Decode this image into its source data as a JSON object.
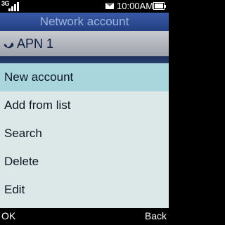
{
  "status_bar": {
    "network_type": "3G",
    "time": "10:00AM",
    "signal_bars": 4,
    "battery_level": 1.0,
    "icons": [
      "signal-icon",
      "message-icon",
      "battery-icon"
    ]
  },
  "title": "Network account",
  "account": {
    "icon": "phone-handset-icon",
    "name": "APN 1"
  },
  "menu": {
    "items": [
      {
        "label": "New account",
        "selected": true
      },
      {
        "label": "Add from list",
        "selected": false
      },
      {
        "label": "Search",
        "selected": false
      },
      {
        "label": "Delete",
        "selected": false
      },
      {
        "label": "Edit",
        "selected": false
      }
    ]
  },
  "softkeys": {
    "left": "OK",
    "right": "Back"
  },
  "colors": {
    "title_bar": "#2f4f95",
    "menu_background": "#dce8e8",
    "menu_selected": "#a9d5dd",
    "account_header": "#b6b9c0"
  }
}
